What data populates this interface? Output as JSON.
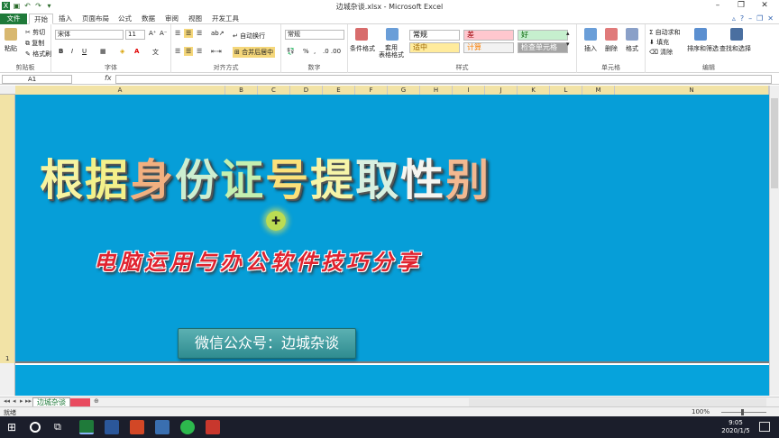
{
  "window": {
    "title": "边城杂谈.xlsx - Microsoft Excel",
    "controls": [
      "–",
      "❐",
      "✕"
    ]
  },
  "tabs": [
    "文件",
    "开始",
    "插入",
    "页面布局",
    "公式",
    "数据",
    "审阅",
    "视图",
    "开发工具"
  ],
  "active_tab": "开始",
  "ribbon": {
    "clipboard": {
      "paste": "粘贴",
      "cut": "剪切",
      "copy": "复制",
      "format_painter": "格式刷",
      "label": "剪贴板"
    },
    "font": {
      "name": "宋体",
      "size": "11",
      "bold": "B",
      "italic": "I",
      "underline": "U",
      "label": "字体"
    },
    "alignment": {
      "wrap": "自动换行",
      "merge": "合并后居中",
      "label": "对齐方式"
    },
    "number": {
      "format": "常规",
      "percent": "%",
      "comma": ",",
      "label": "数字"
    },
    "styles": {
      "conditional": "条件格式",
      "table": "套用\n表格格式",
      "cells": [
        {
          "text": "常规",
          "bg": "#ffffff",
          "color": "#000000"
        },
        {
          "text": "差",
          "bg": "#ffc7ce",
          "color": "#9c0006"
        },
        {
          "text": "好",
          "bg": "#c6efce",
          "color": "#006100"
        },
        {
          "text": "适中",
          "bg": "#ffeb9c",
          "color": "#9c6500"
        },
        {
          "text": "计算",
          "bg": "#f2f2f2",
          "color": "#fa7d00"
        },
        {
          "text": "检查单元格",
          "bg": "#a5a5a5",
          "color": "#ffffff"
        }
      ],
      "label": "样式"
    },
    "cells": {
      "insert": "插入",
      "delete": "删除",
      "format": "格式",
      "label": "单元格"
    },
    "editing": {
      "autosum": "自动求和",
      "fill": "填充",
      "clear": "清除",
      "sort": "排序和筛选",
      "find": "查找和选择",
      "label": "编辑"
    }
  },
  "formula_bar": {
    "name_box": "A1",
    "fx": "fx",
    "value": ""
  },
  "columns": [
    "A",
    "B",
    "C",
    "D",
    "E",
    "F",
    "G",
    "H",
    "I",
    "J",
    "K",
    "L",
    "M",
    "N"
  ],
  "row_number": "1",
  "content": {
    "title_chars": [
      {
        "ch": "根",
        "color": "#f7f3a0"
      },
      {
        "ch": "据",
        "color": "#f4f08a"
      },
      {
        "ch": "身",
        "color": "#f1b080"
      },
      {
        "ch": "份",
        "color": "#cdeed0"
      },
      {
        "ch": "证",
        "color": "#c4f0b0"
      },
      {
        "ch": "号",
        "color": "#fbe07a"
      },
      {
        "ch": "提",
        "color": "#f6f4a8"
      },
      {
        "ch": "取",
        "color": "#d8f0e0"
      },
      {
        "ch": "性",
        "color": "#f5f5f0"
      },
      {
        "ch": "别",
        "color": "#f3b890"
      }
    ],
    "subtitle": "电脑运用与办公软件技巧分享",
    "wechat_button": "微信公众号：边城杂谈"
  },
  "sheets": [
    {
      "name": "边城杂谈",
      "active": true
    }
  ],
  "status": {
    "text": "就绪",
    "zoom": "100%"
  },
  "taskbar": {
    "time": "9:05",
    "date": "2020/1/5"
  }
}
